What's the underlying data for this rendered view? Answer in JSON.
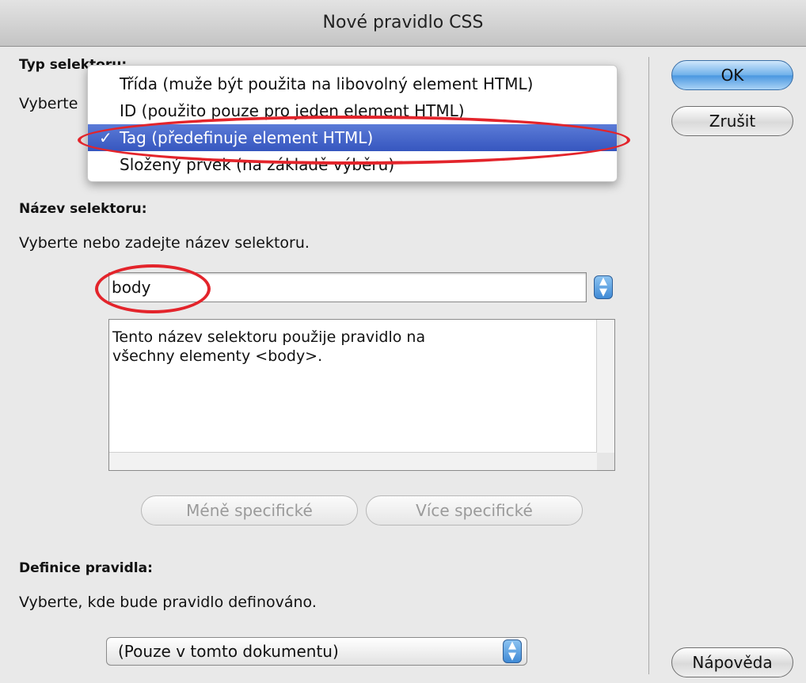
{
  "window": {
    "title": "Nové pravidlo CSS"
  },
  "selector_type": {
    "heading": "Typ selektoru:",
    "prompt_partial": "Vyberte",
    "menu": [
      {
        "label": "Třída (muže být použita na libovolný element HTML)",
        "selected": false
      },
      {
        "label": "ID (použito pouze pro jeden element HTML)",
        "selected": false
      },
      {
        "label": "Tag (předefinuje element HTML)",
        "selected": true,
        "check": "✓"
      },
      {
        "label": "Složený prvek (na základě výběru)",
        "selected": false
      }
    ]
  },
  "selector_name": {
    "heading": "Název selektoru:",
    "prompt": "Vyberte nebo zadejte název selektoru.",
    "value": "body",
    "description": "Tento název selektoru použije pravidlo na\nvšechny elementy <body>.",
    "less_specific": "Méně specifické",
    "more_specific": "Více specifické"
  },
  "rule_definition": {
    "heading": "Definice pravidla:",
    "prompt": "Vyberte, kde bude pravidlo definováno.",
    "value": "(Pouze v tomto dokumentu)"
  },
  "buttons": {
    "ok": "OK",
    "cancel": "Zrušit",
    "help": "Nápověda"
  },
  "annotations": {
    "color": "#e3242b"
  },
  "icons": {
    "stepper": "up-down-arrows-icon"
  }
}
